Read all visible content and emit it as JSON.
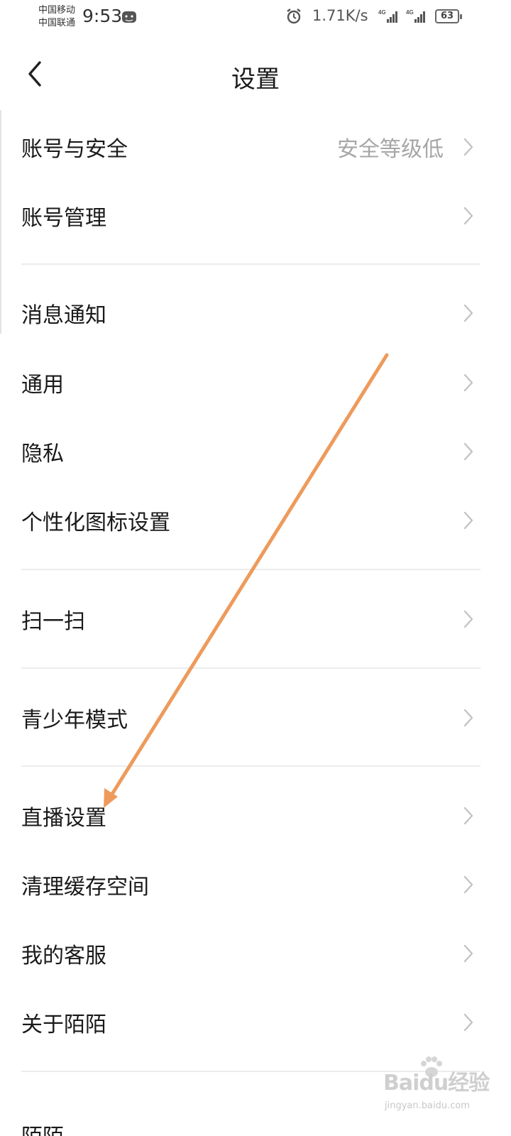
{
  "status_bar": {
    "carrier_1": "中国移动",
    "carrier_2": "中国联通",
    "time": "9:53",
    "net_speed": "1.71K/s",
    "network_1": "4G",
    "network_2": "4G",
    "battery": "63"
  },
  "header": {
    "title": "设置",
    "back_icon": "chevron-left-icon"
  },
  "settings": {
    "account_security": {
      "label": "账号与安全",
      "value": "安全等级低"
    },
    "account_manage": {
      "label": "账号管理"
    },
    "notifications": {
      "label": "消息通知"
    },
    "general": {
      "label": "通用"
    },
    "privacy": {
      "label": "隐私"
    },
    "custom_icon": {
      "label": "个性化图标设置"
    },
    "scan": {
      "label": "扫一扫"
    },
    "teen_mode": {
      "label": "青少年模式"
    },
    "live_settings": {
      "label": "直播设置"
    },
    "clear_cache": {
      "label": "清理缓存空间"
    },
    "customer_service": {
      "label": "我的客服"
    },
    "about": {
      "label": "关于陌陌"
    },
    "partial_next": {
      "label": "陌陌…"
    }
  },
  "watermark": {
    "logo": "Baidu经验",
    "url": "jingyan.baidu.com"
  },
  "colors": {
    "annotation_arrow": "#ee9a5c",
    "chevron": "#c4c4c4",
    "value_text": "#a6a6a6"
  }
}
